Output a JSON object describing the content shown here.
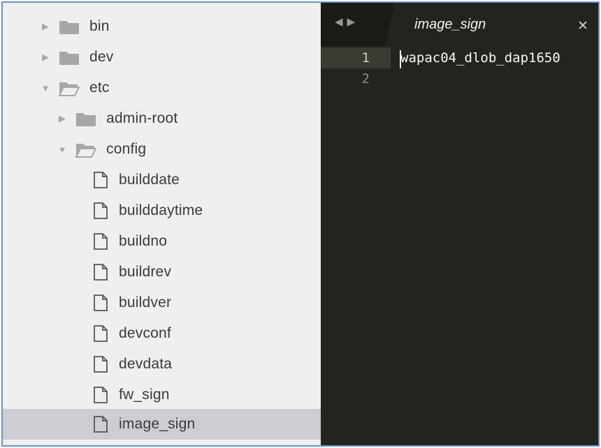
{
  "sidebar": {
    "items": [
      {
        "label": "bin",
        "kind": "folder",
        "expanded": false
      },
      {
        "label": "dev",
        "kind": "folder",
        "expanded": false
      },
      {
        "label": "etc",
        "kind": "folder",
        "expanded": true
      },
      {
        "label": "admin-root",
        "kind": "folder",
        "expanded": false
      },
      {
        "label": "config",
        "kind": "folder",
        "expanded": true
      },
      {
        "label": "builddate",
        "kind": "file"
      },
      {
        "label": "builddaytime",
        "kind": "file"
      },
      {
        "label": "buildno",
        "kind": "file"
      },
      {
        "label": "buildrev",
        "kind": "file"
      },
      {
        "label": "buildver",
        "kind": "file"
      },
      {
        "label": "devconf",
        "kind": "file"
      },
      {
        "label": "devdata",
        "kind": "file"
      },
      {
        "label": "fw_sign",
        "kind": "file"
      },
      {
        "label": "image_sign",
        "kind": "file",
        "selected": true
      }
    ]
  },
  "editor": {
    "tab_title": "image_sign",
    "nav_icons": [
      "left-arrow-icon",
      "right-arrow-icon"
    ],
    "close_icon": "close-icon",
    "line_numbers": [
      "1",
      "2"
    ],
    "lines": [
      "wapac04_dlob_dap1650",
      ""
    ]
  },
  "colors": {
    "sidebar_bg": "#efefef",
    "selected_bg": "#cdcdd3",
    "editor_bg": "#23241f",
    "text": "#f8f8f2"
  }
}
